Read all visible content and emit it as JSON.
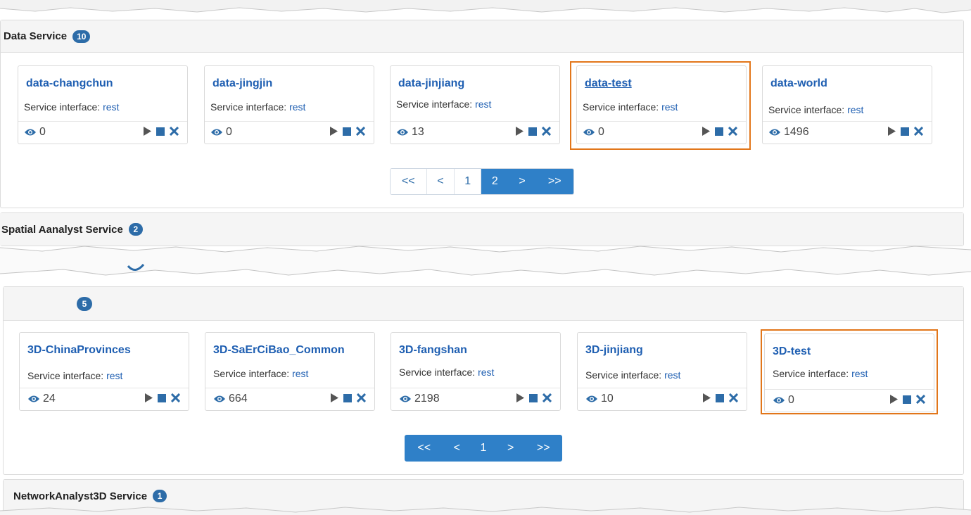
{
  "sections": {
    "data_service": {
      "title": "Data Service",
      "count": "10",
      "cards": [
        {
          "name": "data-changchun",
          "iface_label": "Service interface:",
          "iface_link": "rest",
          "views": "0"
        },
        {
          "name": "data-jingjin",
          "iface_label": "Service interface:",
          "iface_link": "rest",
          "views": "0"
        },
        {
          "name": "data-jinjiang",
          "iface_label": "Service interface:",
          "iface_link": "rest",
          "views": "13"
        },
        {
          "name": "data-test",
          "iface_label": "Service interface:",
          "iface_link": "rest",
          "views": "0"
        },
        {
          "name": "data-world",
          "iface_label": "Service interface:",
          "iface_link": "rest",
          "views": "1496"
        }
      ],
      "pager": [
        "<<",
        "<",
        "1",
        "2",
        ">",
        ">>"
      ],
      "pager_active": "2"
    },
    "spatial": {
      "title": "Spatial Aanalyst Service",
      "count": "2"
    },
    "three_d": {
      "title": "",
      "count": "5",
      "cards": [
        {
          "name": "3D-ChinaProvinces",
          "iface_label": "Service interface:",
          "iface_link": "rest",
          "views": "24"
        },
        {
          "name": "3D-SaErCiBao_Common",
          "iface_label": "Service interface:",
          "iface_link": "rest",
          "views": "664"
        },
        {
          "name": "3D-fangshan",
          "iface_label": "Service interface:",
          "iface_link": "rest",
          "views": "2198"
        },
        {
          "name": "3D-jinjiang",
          "iface_label": "Service interface:",
          "iface_link": "rest",
          "views": "10"
        },
        {
          "name": "3D-test",
          "iface_label": "Service interface:",
          "iface_link": "rest",
          "views": "0"
        }
      ],
      "pager": [
        "<<",
        "<",
        "1",
        ">",
        ">>"
      ]
    },
    "network3d": {
      "title": "NetworkAnalyst3D Service",
      "count": "1"
    }
  },
  "icons": {
    "views": "eye-icon",
    "start": "play-icon",
    "stop": "stop-icon",
    "delete": "close-icon"
  },
  "colors": {
    "link": "#1f5fb2",
    "badge": "#2d6ca8",
    "pager_blue": "#2f80c8",
    "highlight": "#e2761a"
  }
}
